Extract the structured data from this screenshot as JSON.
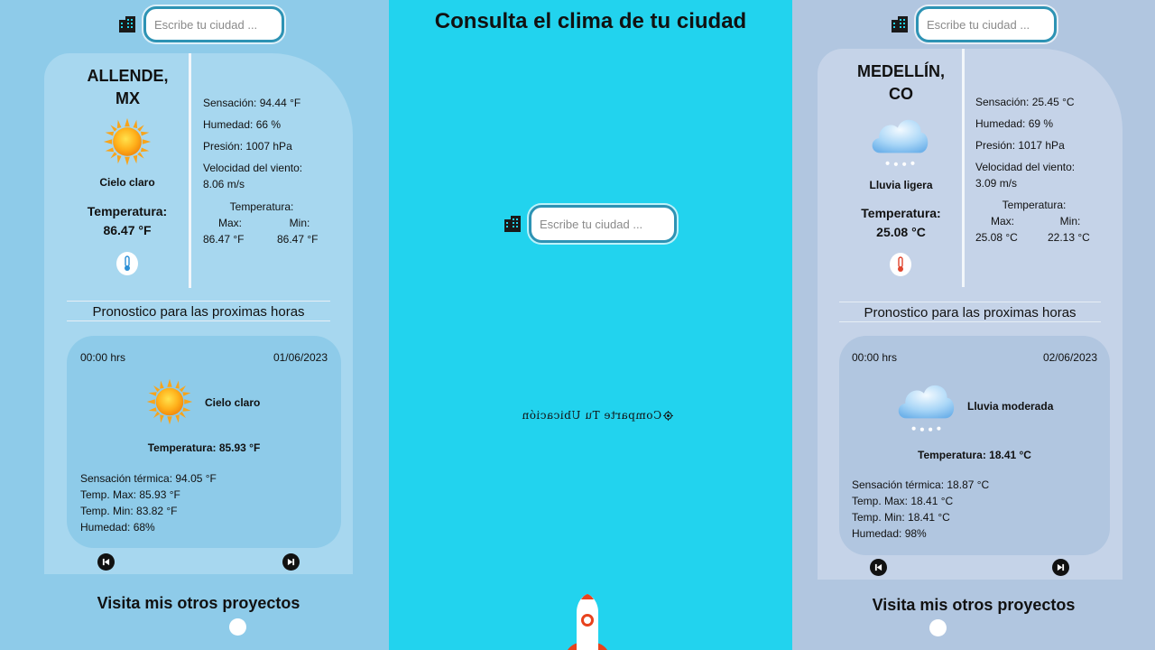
{
  "left": {
    "search": {
      "placeholder": "Escribe tu ciudad ..."
    },
    "city": [
      "ALLENDE,",
      "MX"
    ],
    "weather_icon": "sun-icon",
    "description": "Cielo claro",
    "temp_label": "Temperatura:",
    "temp_value": "86.47 °F",
    "thermometer_icon": "thermometer-cold-icon",
    "stats": {
      "sensacion": "Sensación: 94.44 °F",
      "humedad": "Humedad: 66 %",
      "presion": "Presión: 1007 hPa",
      "viento_label": "Velocidad del viento:",
      "viento_value": "8.06 m/s",
      "temp_label": "Temperatura:",
      "max_label": "Max:",
      "min_label": "Min:",
      "max_value": "86.47 °F",
      "min_value": "86.47 °F"
    },
    "forecast_header": "Pronostico para las proximas horas",
    "forecast": {
      "time": "00:00 hrs",
      "date": "01/06/2023",
      "icon": "sun-icon",
      "description": "Cielo claro",
      "temperature": "Temperatura: 85.93 °F",
      "sensacion": "Sensación térmica: 94.05 °F",
      "max": "Temp. Max: 85.93 °F",
      "min": "Temp. Min: 83.82 °F",
      "humedad": "Humedad: 68%"
    },
    "visit": "Visita mis otros proyectos"
  },
  "center": {
    "title": "Consulta el clima de tu ciudad",
    "search": {
      "placeholder": "Escribe tu ciudad ..."
    },
    "share": "Comparte Tu Ubicación"
  },
  "right": {
    "search": {
      "placeholder": "Escribe tu ciudad ..."
    },
    "city": [
      "MEDELLÍN,",
      "CO"
    ],
    "weather_icon": "rain-cloud-icon",
    "description": "Lluvia ligera",
    "temp_label": "Temperatura:",
    "temp_value": "25.08 °C",
    "thermometer_icon": "thermometer-hot-icon",
    "stats": {
      "sensacion": "Sensación: 25.45 °C",
      "humedad": "Humedad: 69 %",
      "presion": "Presión: 1017 hPa",
      "viento_label": "Velocidad del viento:",
      "viento_value": "3.09 m/s",
      "temp_label": "Temperatura:",
      "max_label": "Max:",
      "min_label": "Min:",
      "max_value": "25.08 °C",
      "min_value": "22.13 °C"
    },
    "forecast_header": "Pronostico para las proximas horas",
    "forecast": {
      "time": "00:00 hrs",
      "date": "02/06/2023",
      "icon": "rain-cloud-icon",
      "description": "Lluvia moderada",
      "temperature": "Temperatura: 18.41 °C",
      "sensacion": "Sensación térmica: 18.87 °C",
      "max": "Temp. Max: 18.41 °C",
      "min": "Temp. Min: 18.41 °C",
      "humedad": "Humedad: 98%"
    },
    "visit": "Visita mis otros proyectos"
  },
  "colors": {
    "left_bg": "#8ecbe9",
    "center_bg": "#22d3ee",
    "right_bg": "#b1c6e0",
    "input_border": "#2d93b4"
  }
}
